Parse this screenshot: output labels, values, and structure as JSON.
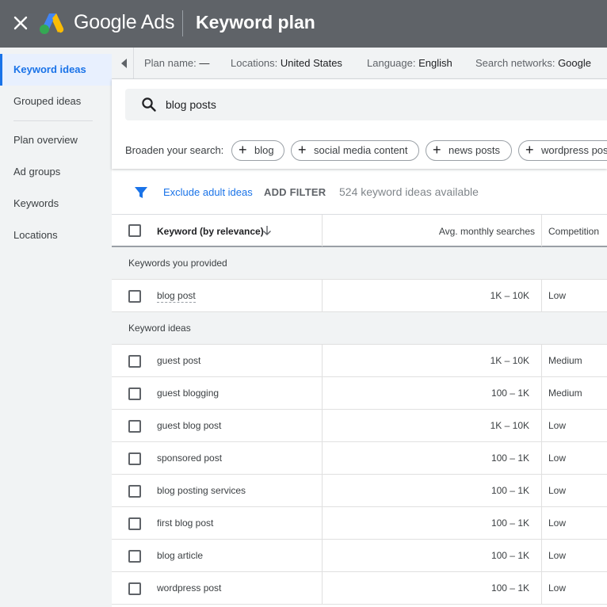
{
  "colors": {
    "topbar": "#5f6368",
    "accent": "#1a73e8",
    "sidebar_bg": "#f1f3f4"
  },
  "header": {
    "close_icon": "close-icon",
    "logo_icon": "google-ads-logo",
    "brand": "Google Ads",
    "title": "Keyword plan"
  },
  "sidebar": {
    "items": [
      {
        "label": "Keyword ideas",
        "active": true
      },
      {
        "label": "Grouped ideas"
      },
      {
        "label": "Plan overview"
      },
      {
        "label": "Ad groups"
      },
      {
        "label": "Keywords"
      },
      {
        "label": "Locations"
      }
    ]
  },
  "planbar": {
    "plan_label": "Plan name:",
    "plan_value": "—",
    "locations_label": "Locations:",
    "locations_value": "United States",
    "language_label": "Language:",
    "language_value": "English",
    "networks_label": "Search networks:",
    "networks_value": "Google"
  },
  "search": {
    "value": "blog posts",
    "broaden_label": "Broaden your search:",
    "chips": [
      "blog",
      "social media content",
      "news posts",
      "wordpress pos"
    ]
  },
  "filters": {
    "exclude": "Exclude adult ideas",
    "add_filter": "ADD FILTER",
    "count": "524 keyword ideas available"
  },
  "table": {
    "headers": {
      "keyword": "Keyword (by relevance)",
      "volume": "Avg. monthly searches",
      "competition": "Competition"
    },
    "group_provided": "Keywords you provided",
    "provided": [
      {
        "keyword": "blog post",
        "volume": "1K – 10K",
        "competition": "Low"
      }
    ],
    "group_ideas": "Keyword ideas",
    "ideas": [
      {
        "keyword": "guest post",
        "volume": "1K – 10K",
        "competition": "Medium"
      },
      {
        "keyword": "guest blogging",
        "volume": "100 – 1K",
        "competition": "Medium"
      },
      {
        "keyword": "guest blog post",
        "volume": "1K – 10K",
        "competition": "Low"
      },
      {
        "keyword": "sponsored post",
        "volume": "100 – 1K",
        "competition": "Low"
      },
      {
        "keyword": "blog posting services",
        "volume": "100 – 1K",
        "competition": "Low"
      },
      {
        "keyword": "first blog post",
        "volume": "100 – 1K",
        "competition": "Low"
      },
      {
        "keyword": "blog article",
        "volume": "100 – 1K",
        "competition": "Low"
      },
      {
        "keyword": "wordpress post",
        "volume": "100 – 1K",
        "competition": "Low"
      }
    ]
  }
}
